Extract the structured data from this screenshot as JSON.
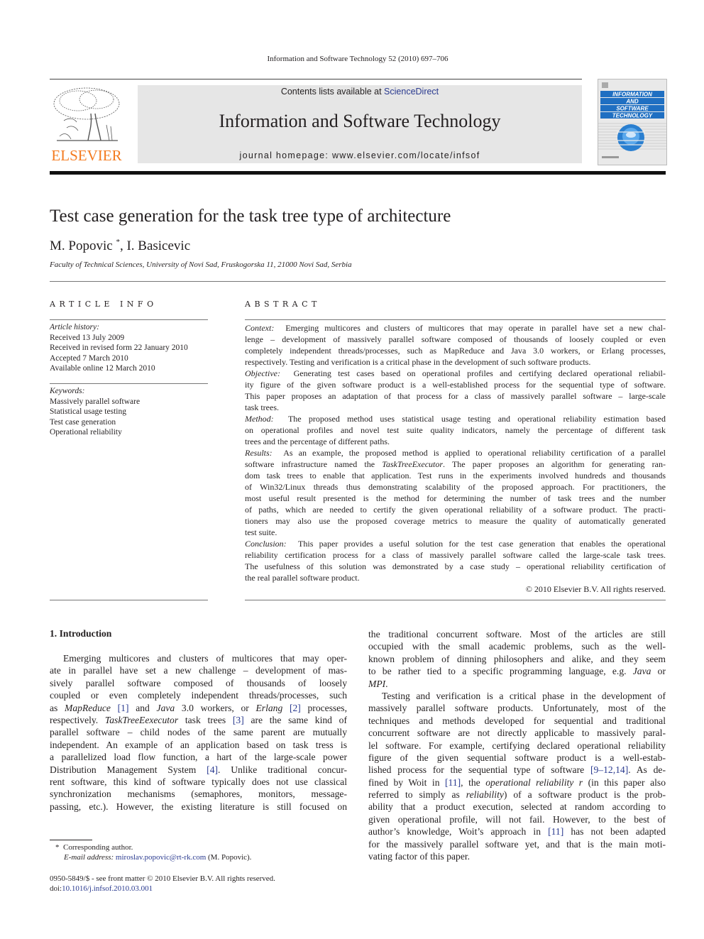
{
  "header": {
    "running_head": "Information and Software Technology 52 (2010) 697–706",
    "publisher_word": "ELSEVIER",
    "contents_prefix": "Contents lists available at ",
    "contents_link": "ScienceDirect",
    "journal_title": "Information and Software Technology",
    "homepage": "journal homepage: www.elsevier.com/locate/infsof",
    "cover_lines": [
      "INFORMATION",
      "AND",
      "SOFTWARE",
      "TECHNOLOGY"
    ],
    "colors": {
      "publisher_orange": "#f47b20",
      "link_blue": "#2a3a8f",
      "band_gray": "#e6e6e6",
      "cover_blue": "#1f6fc2"
    }
  },
  "article": {
    "title": "Test case generation for the task tree type of architecture",
    "author1": "M. Popovic",
    "author1_mark": "*",
    "author_sep": ", ",
    "author2": "I. Basicevic",
    "affiliation": "Faculty of Technical Sciences, University of Novi Sad, Fruskogorska 11, 21000 Novi Sad, Serbia"
  },
  "article_info": {
    "heading": "ARTICLE INFO",
    "history_label": "Article history:",
    "history": [
      "Received 13 July 2009",
      "Received in revised form 22 January 2010",
      "Accepted 7 March 2010",
      "Available online 12 March 2010"
    ],
    "keywords_label": "Keywords:",
    "keywords": [
      "Massively parallel software",
      "Statistical usage testing",
      "Test case generation",
      "Operational reliability"
    ]
  },
  "abstract": {
    "heading": "ABSTRACT",
    "context_label": "Context:",
    "context_lines": [
      "Emerging multicores and clusters of multicores that may operate in parallel have set a new chal-",
      "lenge – development of massively parallel software composed of thousands of loosely coupled or even",
      "completely independent threads/processes, such as MapReduce and Java 3.0 workers, or Erlang processes,",
      "respectively. Testing and verification is a critical phase in the development of such software products."
    ],
    "objective_label": "Objective:",
    "objective_lines": [
      "Generating test cases based on operational profiles and certifying declared operational reliabil-",
      "ity figure of the given software product is a well-established process for the sequential type of software.",
      "This paper proposes an adaptation of that process for a class of massively parallel software – large-scale",
      "task trees."
    ],
    "method_label": "Method:",
    "method_lines": [
      "The proposed method uses statistical usage testing and operational reliability estimation based",
      "on operational profiles and novel test suite quality indicators, namely the percentage of different task",
      "trees and the percentage of different paths."
    ],
    "results_label": "Results:",
    "results_line1": "As an example, the proposed method is applied to operational reliability certification of a parallel",
    "results_line2_a": "software infrastructure named the ",
    "results_line2_it": "TaskTreeExecutor",
    "results_line2_b": ". The paper proposes an algorithm for generating ran-",
    "results_lines_rest": [
      "dom task trees to enable that application. Test runs in the experiments involved hundreds and thousands",
      "of Win32/Linux threads thus demonstrating scalability of the proposed approach. For practitioners, the",
      "most useful result presented is the method for determining the number of task trees and the number",
      "of paths, which are needed to certify the given operational reliability of a software product. The practi-",
      "tioners may also use the proposed coverage metrics to measure the quality of automatically generated",
      "test suite."
    ],
    "conclusion_label": "Conclusion:",
    "conclusion_lines": [
      "This paper provides a useful solution for the test case generation that enables the operational",
      "reliability certification process for a class of massively parallel software called the large-scale task trees.",
      "The usefulness of this solution was demonstrated by a case study – operational reliability certification of",
      "the real parallel software product."
    ],
    "copyright": "© 2010 Elsevier B.V. All rights reserved."
  },
  "intro": {
    "heading": "1. Introduction",
    "left": {
      "l1": "Emerging multicores and clusters of multicores that may oper-",
      "l2": "ate in parallel have set a new challenge – development of mas-",
      "l3": "sively parallel software composed of thousands of loosely",
      "l4": "coupled or even completely independent threads/processes, such",
      "l5_a": "as ",
      "l5_it1": "MapReduce",
      "l5_ref1": "[1]",
      "l5_b": " and ",
      "l5_it2": "Java",
      "l5_c": " 3.0 workers, or ",
      "l5_it3": "Erlang",
      "l5_ref2": "[2]",
      "l5_d": " processes,",
      "l6_a": "respectively. ",
      "l6_it": "TaskTreeEexecutor",
      "l6_b": " task trees ",
      "l6_ref": "[3]",
      "l6_c": " are the same kind of",
      "l7": "parallel software – child nodes of the same parent are mutually",
      "l8": "independent. An example of an application based on task tress is",
      "l9": "a parallelized load flow function, a hart of the large-scale power",
      "l10_a": "Distribution Management System ",
      "l10_ref": "[4]",
      "l10_b": ". Unlike traditional concur-",
      "l11": "rent software, this kind of software typically does not use classical",
      "l12": "synchronization mechanisms (semaphores, monitors, message-",
      "l13": "passing, etc.). However, the existing literature is still focused on"
    },
    "right": {
      "l1": "the traditional concurrent software. Most of the articles are still",
      "l2": "occupied with the small academic problems, such as the well-",
      "l3": "known problem of dinning philosophers and alike, and they seem",
      "l4_a": "to be rather tied to a specific programming language, e.g. ",
      "l4_it": "Java",
      "l4_b": " or",
      "l5_it": "MPI",
      "l5_b": ".",
      "l6": "Testing and verification is a critical phase in the development of",
      "l7": "massively parallel software products. Unfortunately, most of the",
      "l8": "techniques and methods developed for sequential and traditional",
      "l9": "concurrent software are not directly applicable to massively paral-",
      "l10": "lel software. For example, certifying declared operational reliability",
      "l11": "figure of the given sequential software product is a well-estab-",
      "l12_a": "lished process for the sequential type of software ",
      "l12_ref": "[9–12,14]",
      "l12_b": ". As de-",
      "l13_a": "fined by Woit in ",
      "l13_ref": "[11]",
      "l13_b": ", the ",
      "l13_it": "operational reliability r",
      "l13_c": " (in this paper also",
      "l14_a": "referred to simply as ",
      "l14_it": "reliability",
      "l14_b": ") of a software product is the prob-",
      "l15": "ability that a product execution, selected at random according to",
      "l16": "given operational profile, will not fail. However, to the best of",
      "l17_a": "author’s knowledge, Woit’s approach in ",
      "l17_ref": "[11]",
      "l17_b": " has not been adapted",
      "l18": "for the massively parallel software yet, and that is the main moti-",
      "l19": "vating factor of this paper."
    }
  },
  "footnotes": {
    "mark": "*",
    "corresponding": "Corresponding author.",
    "email_label": "E-mail address:",
    "email": "miroslav.popovic@rt-rk.com",
    "email_suffix": " (M. Popovic).",
    "issn_line": "0950-5849/$ - see front matter © 2010 Elsevier B.V. All rights reserved.",
    "doi_prefix": "doi:",
    "doi": "10.1016/j.infsof.2010.03.001"
  }
}
